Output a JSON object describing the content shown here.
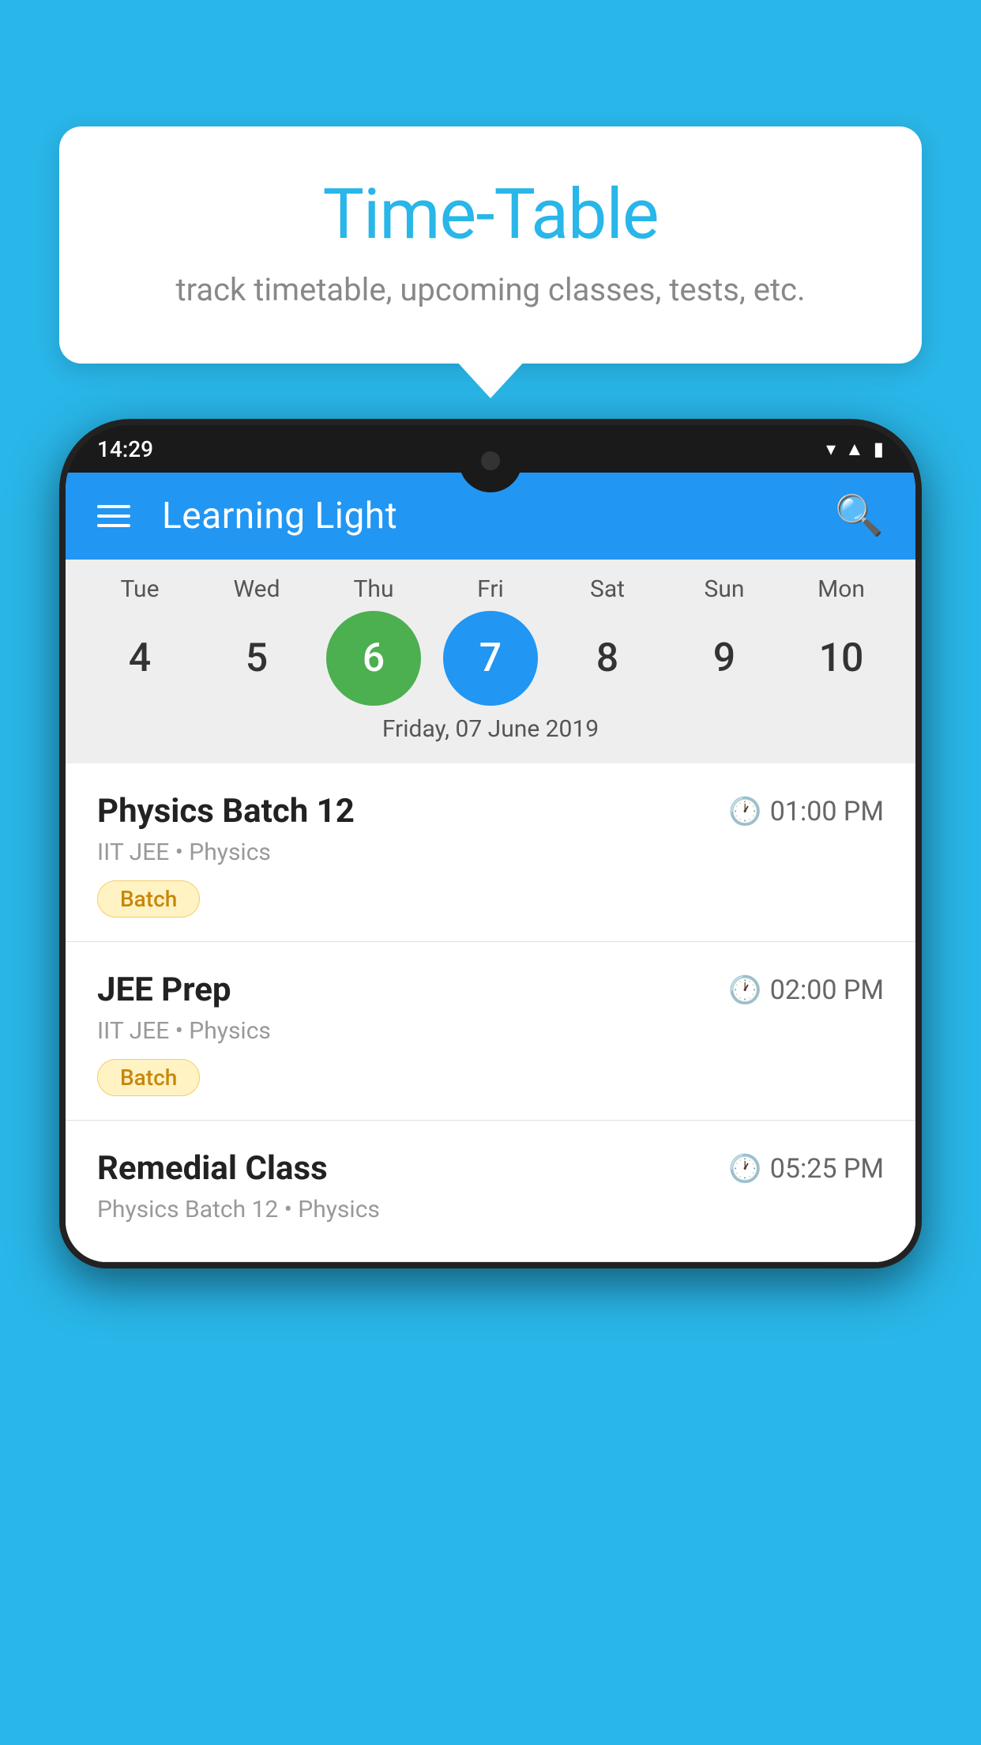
{
  "background_color": "#29B6E8",
  "bubble": {
    "title": "Time-Table",
    "subtitle": "track timetable, upcoming classes, tests, etc."
  },
  "app": {
    "title": "Learning Light",
    "menu_icon_label": "menu",
    "search_icon_label": "search"
  },
  "status_bar": {
    "time": "14:29"
  },
  "calendar": {
    "days": [
      {
        "label": "Tue",
        "number": "4"
      },
      {
        "label": "Wed",
        "number": "5"
      },
      {
        "label": "Thu",
        "number": "6",
        "state": "today"
      },
      {
        "label": "Fri",
        "number": "7",
        "state": "selected"
      },
      {
        "label": "Sat",
        "number": "8"
      },
      {
        "label": "Sun",
        "number": "9"
      },
      {
        "label": "Mon",
        "number": "10"
      }
    ],
    "selected_date_label": "Friday, 07 June 2019"
  },
  "schedule": {
    "items": [
      {
        "title": "Physics Batch 12",
        "time": "01:00 PM",
        "meta": "IIT JEE • Physics",
        "badge": "Batch"
      },
      {
        "title": "JEE Prep",
        "time": "02:00 PM",
        "meta": "IIT JEE • Physics",
        "badge": "Batch"
      },
      {
        "title": "Remedial Class",
        "time": "05:25 PM",
        "meta": "Physics Batch 12 • Physics",
        "badge": null
      }
    ]
  }
}
